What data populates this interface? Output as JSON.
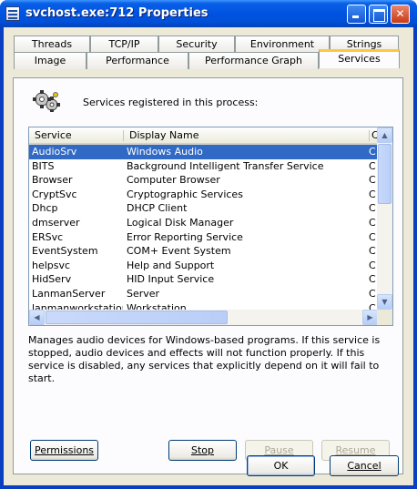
{
  "window": {
    "title": "svchost.exe:712 Properties"
  },
  "tabs": {
    "row1": [
      "Threads",
      "TCP/IP",
      "Security",
      "Environment",
      "Strings"
    ],
    "row2": [
      "Image",
      "Performance",
      "Performance Graph",
      "Services"
    ],
    "active": "Services"
  },
  "services_tab": {
    "header_text": "Services registered in this process:",
    "columns": [
      "Service",
      "Display Name",
      "C"
    ],
    "rows": [
      {
        "service": "AudioSrv",
        "display": "Windows Audio",
        "extra": "C"
      },
      {
        "service": "BITS",
        "display": "Background Intelligent Transfer Service",
        "extra": "C"
      },
      {
        "service": "Browser",
        "display": "Computer Browser",
        "extra": "C"
      },
      {
        "service": "CryptSvc",
        "display": "Cryptographic Services",
        "extra": "C"
      },
      {
        "service": "Dhcp",
        "display": "DHCP Client",
        "extra": "C"
      },
      {
        "service": "dmserver",
        "display": "Logical Disk Manager",
        "extra": "C"
      },
      {
        "service": "ERSvc",
        "display": "Error Reporting Service",
        "extra": "C"
      },
      {
        "service": "EventSystem",
        "display": "COM+ Event System",
        "extra": "C"
      },
      {
        "service": "helpsvc",
        "display": "Help and Support",
        "extra": "C"
      },
      {
        "service": "HidServ",
        "display": "HID Input Service",
        "extra": "C"
      },
      {
        "service": "LanmanServer",
        "display": "Server",
        "extra": "C"
      },
      {
        "service": "lanmanworkstation",
        "display": "Workstation",
        "extra": "C"
      }
    ],
    "selected_service": "AudioSrv",
    "description": "Manages audio devices for Windows-based programs.  If this service is stopped, audio devices and effects will not function properly.  If this service is disabled, any services that explicitly depend on it will fail to start.",
    "buttons": {
      "permissions": "Permissions",
      "stop": "Stop",
      "pause": "Pause",
      "resume": "Resume"
    }
  },
  "dialog_buttons": {
    "ok": "OK",
    "cancel": "Cancel"
  },
  "icons": {
    "title": "window-icon",
    "services": "gears-icon"
  },
  "colors": {
    "titlebar": "#0053e1",
    "selection": "#316ac5",
    "active_tab_accent": "#ffc83c"
  }
}
